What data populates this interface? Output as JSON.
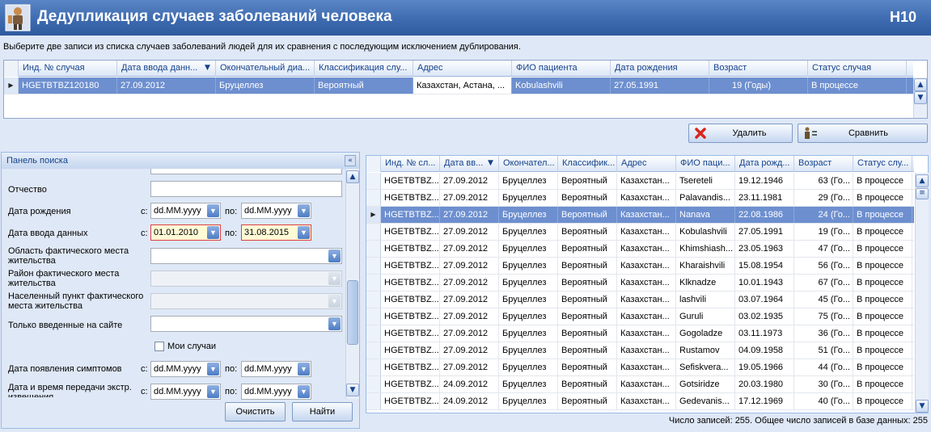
{
  "window": {
    "title": "Дедупликация случаев заболеваний человека",
    "code": "H10"
  },
  "instruction": "Выберите две записи из списка случаев заболеваний людей для их сравнения с последующим исключением дублирования.",
  "top_grid": {
    "columns": [
      "Инд. № случая",
      "Дата ввода данн...",
      "Окончательный диа...",
      "Классификация слу...",
      "Адрес",
      "ФИО пациента",
      "Дата рождения",
      "Возраст",
      "Статус случая"
    ],
    "sort_indicator": "▼",
    "rows": [
      [
        "HGETBTBZ120180",
        "27.09.2012",
        "Бруцеллез",
        "Вероятный",
        "Казахстан, Астана, ...",
        "Kobulashvili",
        "27.05.1991",
        "19 (Годы)",
        "В процессе"
      ]
    ]
  },
  "actions": {
    "delete_label": "Удалить",
    "compare_label": "Сравнить"
  },
  "search_panel": {
    "title": "Панель поиска",
    "labels": {
      "patronymic": "Отчество",
      "birth_date": "Дата рождения",
      "entry_date": "Дата ввода данных",
      "region": "Область фактического места жительства",
      "district": "Район фактического места жительства",
      "settlement": "Населенный пункт фактического места жительства",
      "site_only": "Только введенные на сайте",
      "my_cases": "Мои случаи",
      "symptom_date": "Дата появления симптомов",
      "transfer_date": "Дата и время передачи экстр. извещения"
    },
    "from": "с:",
    "to": "по:",
    "date_placeholder": "dd.MM.yyyy",
    "entry_from": "01.01.2010",
    "entry_to": "31.08.2015",
    "clear_label": "Очистить",
    "find_label": "Найти"
  },
  "main_grid": {
    "columns": [
      "Инд. № сл...",
      "Дата вв...",
      "Окончател...",
      "Классифик...",
      "Адрес",
      "ФИО паци...",
      "Дата рожд...",
      "Возраст",
      "Статус слу..."
    ],
    "sort_indicator": "▼",
    "selected_index": 2,
    "rows": [
      [
        "HGETBTBZ...",
        "27.09.2012",
        "Бруцеллез",
        "Вероятный",
        "Казахстан...",
        "Tsereteli",
        "19.12.1946",
        "63 (Го...",
        "В процессе"
      ],
      [
        "HGETBTBZ...",
        "27.09.2012",
        "Бруцеллез",
        "Вероятный",
        "Казахстан...",
        "Palavandis...",
        "23.11.1981",
        "29 (Го...",
        "В процессе"
      ],
      [
        "HGETBTBZ...",
        "27.09.2012",
        "Бруцеллез",
        "Вероятный",
        "Казахстан...",
        "Nanava",
        "22.08.1986",
        "24 (Го...",
        "В процессе"
      ],
      [
        "HGETBTBZ...",
        "27.09.2012",
        "Бруцеллез",
        "Вероятный",
        "Казахстан...",
        "Kobulashvili",
        "27.05.1991",
        "19 (Го...",
        "В процессе"
      ],
      [
        "HGETBTBZ...",
        "27.09.2012",
        "Бруцеллез",
        "Вероятный",
        "Казахстан...",
        "Khimshiash...",
        "23.05.1963",
        "47 (Го...",
        "В процессе"
      ],
      [
        "HGETBTBZ...",
        "27.09.2012",
        "Бруцеллез",
        "Вероятный",
        "Казахстан...",
        "Kharaishvili",
        "15.08.1954",
        "56 (Го...",
        "В процессе"
      ],
      [
        "HGETBTBZ...",
        "27.09.2012",
        "Бруцеллез",
        "Вероятный",
        "Казахстан...",
        "Klknadze",
        "10.01.1943",
        "67 (Го...",
        "В процессе"
      ],
      [
        "HGETBTBZ...",
        "27.09.2012",
        "Бруцеллез",
        "Вероятный",
        "Казахстан...",
        "lashvili",
        "03.07.1964",
        "45 (Го...",
        "В процессе"
      ],
      [
        "HGETBTBZ...",
        "27.09.2012",
        "Бруцеллез",
        "Вероятный",
        "Казахстан...",
        "Guruli",
        "03.02.1935",
        "75 (Го...",
        "В процессе"
      ],
      [
        "HGETBTBZ...",
        "27.09.2012",
        "Бруцеллез",
        "Вероятный",
        "Казахстан...",
        "Gogoladze",
        "03.11.1973",
        "36 (Го...",
        "В процессе"
      ],
      [
        "HGETBTBZ...",
        "27.09.2012",
        "Бруцеллез",
        "Вероятный",
        "Казахстан...",
        "Rustamov",
        "04.09.1958",
        "51 (Го...",
        "В процессе"
      ],
      [
        "HGETBTBZ...",
        "27.09.2012",
        "Бруцеллез",
        "Вероятный",
        "Казахстан...",
        "Sefiskvera...",
        "19.05.1966",
        "44 (Го...",
        "В процессе"
      ],
      [
        "HGETBTBZ...",
        "24.09.2012",
        "Бруцеллез",
        "Вероятный",
        "Казахстан...",
        "Gotsiridze",
        "20.03.1980",
        "30 (Го...",
        "В процессе"
      ],
      [
        "HGETBTBZ...",
        "24.09.2012",
        "Бруцеллез",
        "Вероятный",
        "Казахстан...",
        "Gedevanis...",
        "17.12.1969",
        "40 (Го...",
        "В процессе"
      ]
    ]
  },
  "status_text": "Число записей: 255. Общее число записей в базе данных: 255",
  "colors": {
    "title_bar": "#3e6bb0",
    "selected_row": "#6d8fcf",
    "header_text": "#15428b",
    "required_border": "#e04040"
  },
  "icons": {
    "app": "person-icon",
    "delete": "red-x-icon",
    "compare": "compare-persons-icon",
    "dropdown": "chevron-down-icon"
  }
}
